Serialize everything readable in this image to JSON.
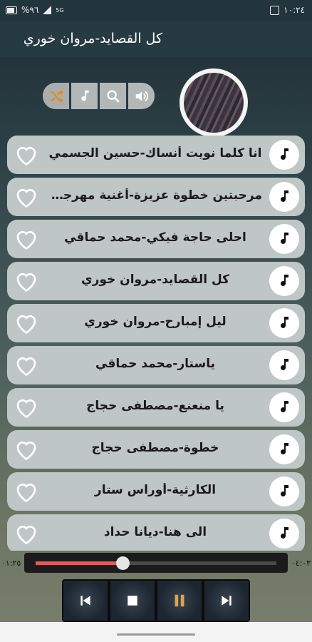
{
  "status_bar": {
    "battery": "%٩٦",
    "network": "5G",
    "time": "١٠:٢٤"
  },
  "header": {
    "title": "كل القصايد-مروان خوري"
  },
  "toolbar": {
    "icons": [
      "shuffle-icon",
      "music-note-icon",
      "search-icon",
      "volume-icon"
    ]
  },
  "songs": [
    {
      "title": "انا كلما نويت أنساك-حسين الجسمي"
    },
    {
      "title": "مرحبتين خطوة عزيزة-أغنية مهرجان"
    },
    {
      "title": "احلى حاجة فيكي-محمد حماقي"
    },
    {
      "title": "كل القصايد-مروان خوري"
    },
    {
      "title": "ليل إمبارح-مروان خوري"
    },
    {
      "title": "ياستار-محمد حماقي"
    },
    {
      "title": "يا منعنع-مصطفى حجاج"
    },
    {
      "title": "خطوة-مصطفى حجاج"
    },
    {
      "title": "الكارثية-أوراس ستار"
    },
    {
      "title": "الى هنا-ديانا حداد"
    }
  ],
  "seek": {
    "elapsed": "٠١:٢٥",
    "duration": "٠٤:٠٣",
    "progress": 0.36
  },
  "player": {
    "buttons": [
      "previous-icon",
      "stop-icon",
      "pause-icon",
      "next-icon"
    ]
  },
  "colors": {
    "accent": "#e45a5a",
    "pause": "#f0a030"
  }
}
